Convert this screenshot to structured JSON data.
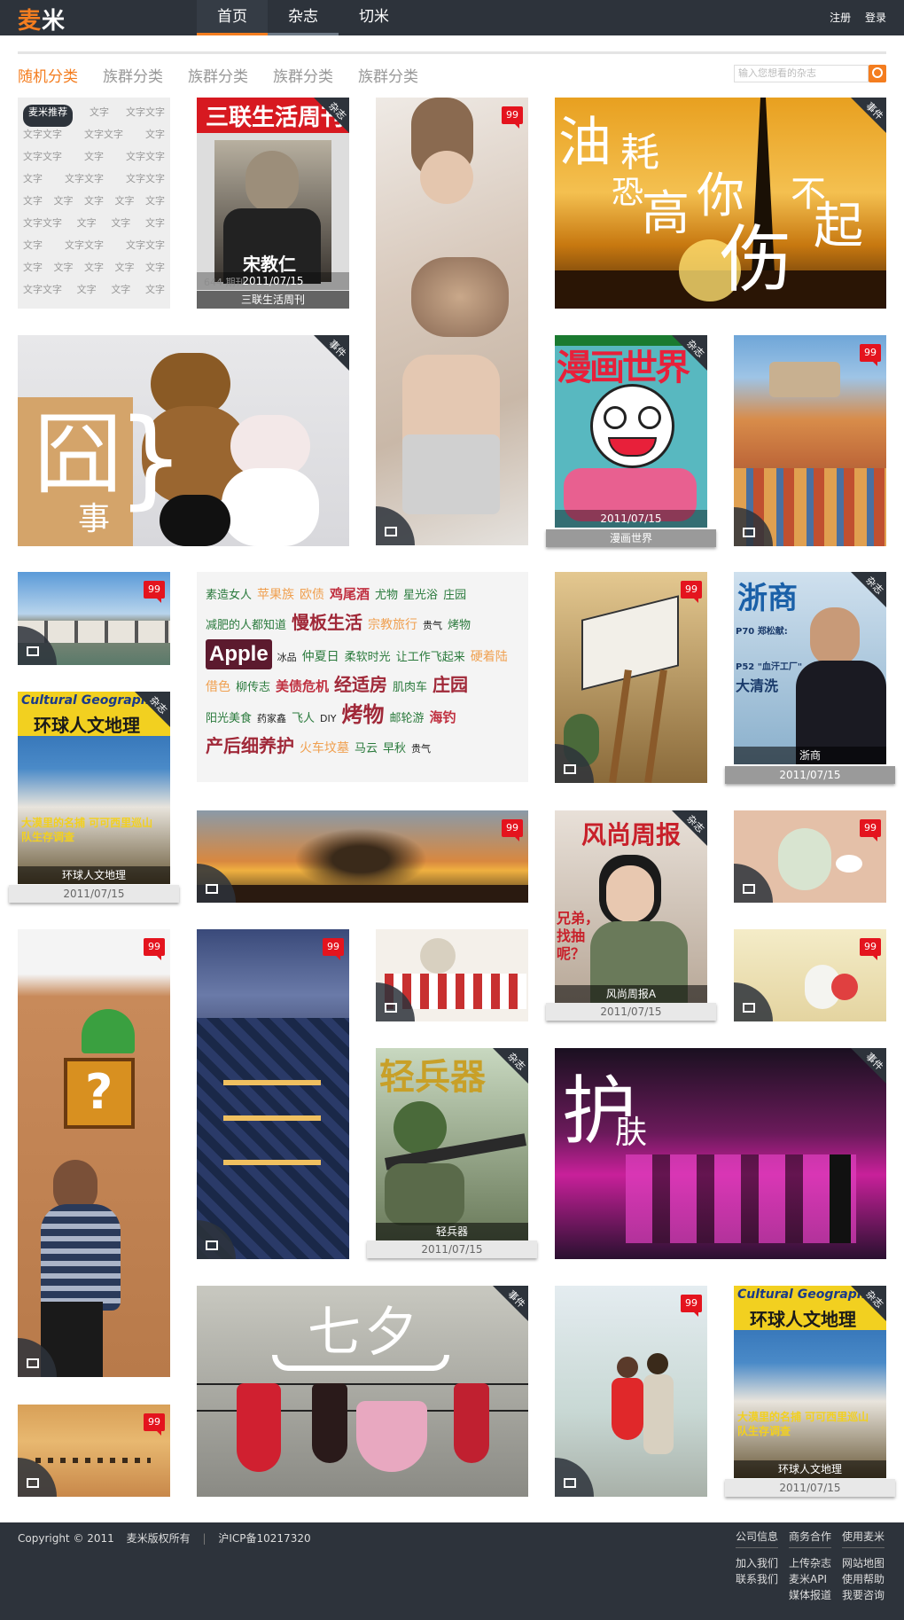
{
  "header": {
    "logo_a": "麦",
    "logo_b": "米",
    "nav": [
      "首页",
      "杂志",
      "切米"
    ],
    "register": "注册",
    "login": "登录"
  },
  "categories": [
    "随机分类",
    "族群分类",
    "族群分类",
    "族群分类",
    "族群分类"
  ],
  "search": {
    "placeholder": "输入您想看的杂志"
  },
  "tagbox": {
    "rows": [
      [
        "麦米推荐",
        "文字",
        "文字文字"
      ],
      [
        "文字文字",
        "文字文字",
        "文字"
      ],
      [
        "文字文字",
        "文字",
        "文字文字"
      ],
      [
        "文字",
        "文字文字",
        "文字文字"
      ],
      [
        "文字",
        "文字",
        "文字",
        "文字",
        "文字"
      ],
      [
        "文字文字",
        "文字",
        "文字",
        "文字"
      ],
      [
        "文字",
        "文字文字",
        "文字文字"
      ],
      [
        "文字",
        "文字",
        "文字",
        "文字",
        "文字"
      ],
      [
        "文字文字",
        "文字",
        "文字",
        "文字"
      ]
    ]
  },
  "labels": {
    "magazine": "杂志",
    "event": "事件",
    "count": "99"
  },
  "magazines": {
    "sanlian": {
      "title": "三联生活周刊",
      "date": "2011/07/15",
      "cover_title": "三联生活周刊",
      "cover_person": "宋教仁",
      "issue": "644 期刊"
    },
    "manhua": {
      "title": "漫画世界",
      "date": "2011/07/15",
      "cover_title": "漫画世界"
    },
    "zheshang": {
      "title": "浙商",
      "date": "2011/07/15",
      "cover_title": "浙商",
      "line1": "P70 郑松献:",
      "line2": "P52 \"血汗工厂\"",
      "line3": "大清洗"
    },
    "huanqiu": {
      "title": "环球人文地理",
      "date": "2011/07/15",
      "cover_en": "Cultural Geography",
      "cover_cn": "环球人文地理",
      "cover_sub": "大漠里的名捕 可可西里巡山队生存调查"
    },
    "fengshang": {
      "title": "风尚周报A",
      "date": "2011/07/15",
      "cover_title": "风尚周报",
      "cover_sub": "兄弟，找抽呢？"
    },
    "qingbingqi": {
      "title": "轻兵器",
      "date": "2011/07/15",
      "cover_title": "轻兵器"
    },
    "huanqiu2": {
      "title": "环球人文地理",
      "date": "2011/07/15"
    }
  },
  "events": {
    "oil": {
      "l1": "油",
      "l2": "耗",
      "l3": "恐",
      "l4": "高",
      "l5": "你",
      "l6": "伤",
      "l7": "不",
      "l8": "起"
    },
    "jiong": {
      "big": "囧",
      "small": "事"
    },
    "hufu": {
      "big": "护",
      "small": "肤"
    },
    "qixi": {
      "text": "七夕"
    }
  },
  "cloud": [
    {
      "t": "素造女人",
      "c": "#2a7a3c",
      "s": 13
    },
    {
      "t": "苹果族",
      "c": "#f0a050",
      "s": 14
    },
    {
      "t": "欧债",
      "c": "#f0a050",
      "s": 14
    },
    {
      "t": "鸡尾酒",
      "c": "#c03040",
      "s": 15,
      "b": true
    },
    {
      "t": "尤物",
      "c": "#2a7a3c",
      "s": 13
    },
    {
      "t": "星光浴",
      "c": "#2a7a3c",
      "s": 13
    },
    {
      "t": "庄园",
      "c": "#2a7a3c",
      "s": 13
    },
    {
      "t": "减肥的人都知道",
      "c": "#2a7a3c",
      "s": 13
    },
    {
      "t": "慢板生活",
      "c": "#a02838",
      "s": 20,
      "b": true
    },
    {
      "t": "宗教旅行",
      "c": "#f0a050",
      "s": 14
    },
    {
      "t": "贵气",
      "c": "#222",
      "s": 11
    },
    {
      "t": "烤物",
      "c": "#2a7a3c",
      "s": 13
    },
    {
      "t": "Apple",
      "c": "#fff",
      "s": 24,
      "b": true,
      "bg": "#5c1a2e"
    },
    {
      "t": "冰品",
      "c": "#222",
      "s": 11
    },
    {
      "t": "仲夏日",
      "c": "#2a7a3c",
      "s": 14
    },
    {
      "t": "柔软时光",
      "c": "#2a7a3c",
      "s": 13
    },
    {
      "t": "让工作飞起来",
      "c": "#2a7a3c",
      "s": 13
    },
    {
      "t": "硬着陆",
      "c": "#f0a050",
      "s": 14
    },
    {
      "t": "借色",
      "c": "#f0a050",
      "s": 14
    },
    {
      "t": "柳传志",
      "c": "#2a7a3c",
      "s": 13
    },
    {
      "t": "美债危机",
      "c": "#c03040",
      "s": 15,
      "b": true
    },
    {
      "t": "经适房",
      "c": "#a02838",
      "s": 20,
      "b": true
    },
    {
      "t": "肌肉车",
      "c": "#2a7a3c",
      "s": 13
    },
    {
      "t": "庄园",
      "c": "#a02838",
      "s": 20,
      "b": true
    },
    {
      "t": "阳光美食",
      "c": "#2a7a3c",
      "s": 13
    },
    {
      "t": "药家鑫",
      "c": "#222",
      "s": 11
    },
    {
      "t": "飞人",
      "c": "#2a7a3c",
      "s": 13
    },
    {
      "t": "DIY",
      "c": "#222",
      "s": 11
    },
    {
      "t": "烤物",
      "c": "#a02838",
      "s": 24,
      "b": true
    },
    {
      "t": "邮轮游",
      "c": "#2a7a3c",
      "s": 13
    },
    {
      "t": "海钓",
      "c": "#c03040",
      "s": 15,
      "b": true
    },
    {
      "t": "产后细养护",
      "c": "#a02838",
      "s": 20,
      "b": true
    },
    {
      "t": "火车坟墓",
      "c": "#f0a050",
      "s": 14
    },
    {
      "t": "马云",
      "c": "#2a7a3c",
      "s": 13
    },
    {
      "t": "早秋",
      "c": "#2a7a3c",
      "s": 13
    },
    {
      "t": "贵气",
      "c": "#222",
      "s": 11
    }
  ],
  "footer": {
    "copyright": "Copyright © 2011",
    "rights": "麦米版权所有",
    "icp": "沪ICP备10217320",
    "headings": [
      "公司信息",
      "商务合作",
      "使用麦米"
    ],
    "col1": [
      "加入我们",
      "联系我们"
    ],
    "col2": [
      "上传杂志",
      "麦米API",
      "媒体报道"
    ],
    "col3": [
      "网站地图",
      "使用帮助",
      "我要咨询"
    ]
  }
}
